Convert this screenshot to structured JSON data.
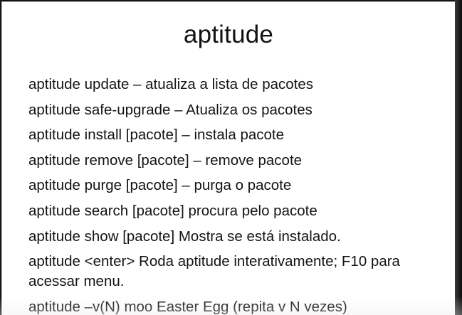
{
  "slide": {
    "title": "aptitude",
    "bullets": [
      "aptitude update – atualiza a lista de pacotes",
      "aptitude safe-upgrade – Atualiza os pacotes",
      "aptitude install [pacote] – instala pacote",
      "aptitude remove [pacote] – remove pacote",
      "aptitude purge [pacote] – purga o pacote",
      "aptitude search [pacote] procura pelo pacote",
      "aptitude show [pacote] Mostra se está instalado.",
      "aptitude <enter> Roda aptitude interativamente; F10 para acessar menu.",
      "aptitude –v(N) moo   Easter Egg (repita v N vezes)"
    ]
  }
}
